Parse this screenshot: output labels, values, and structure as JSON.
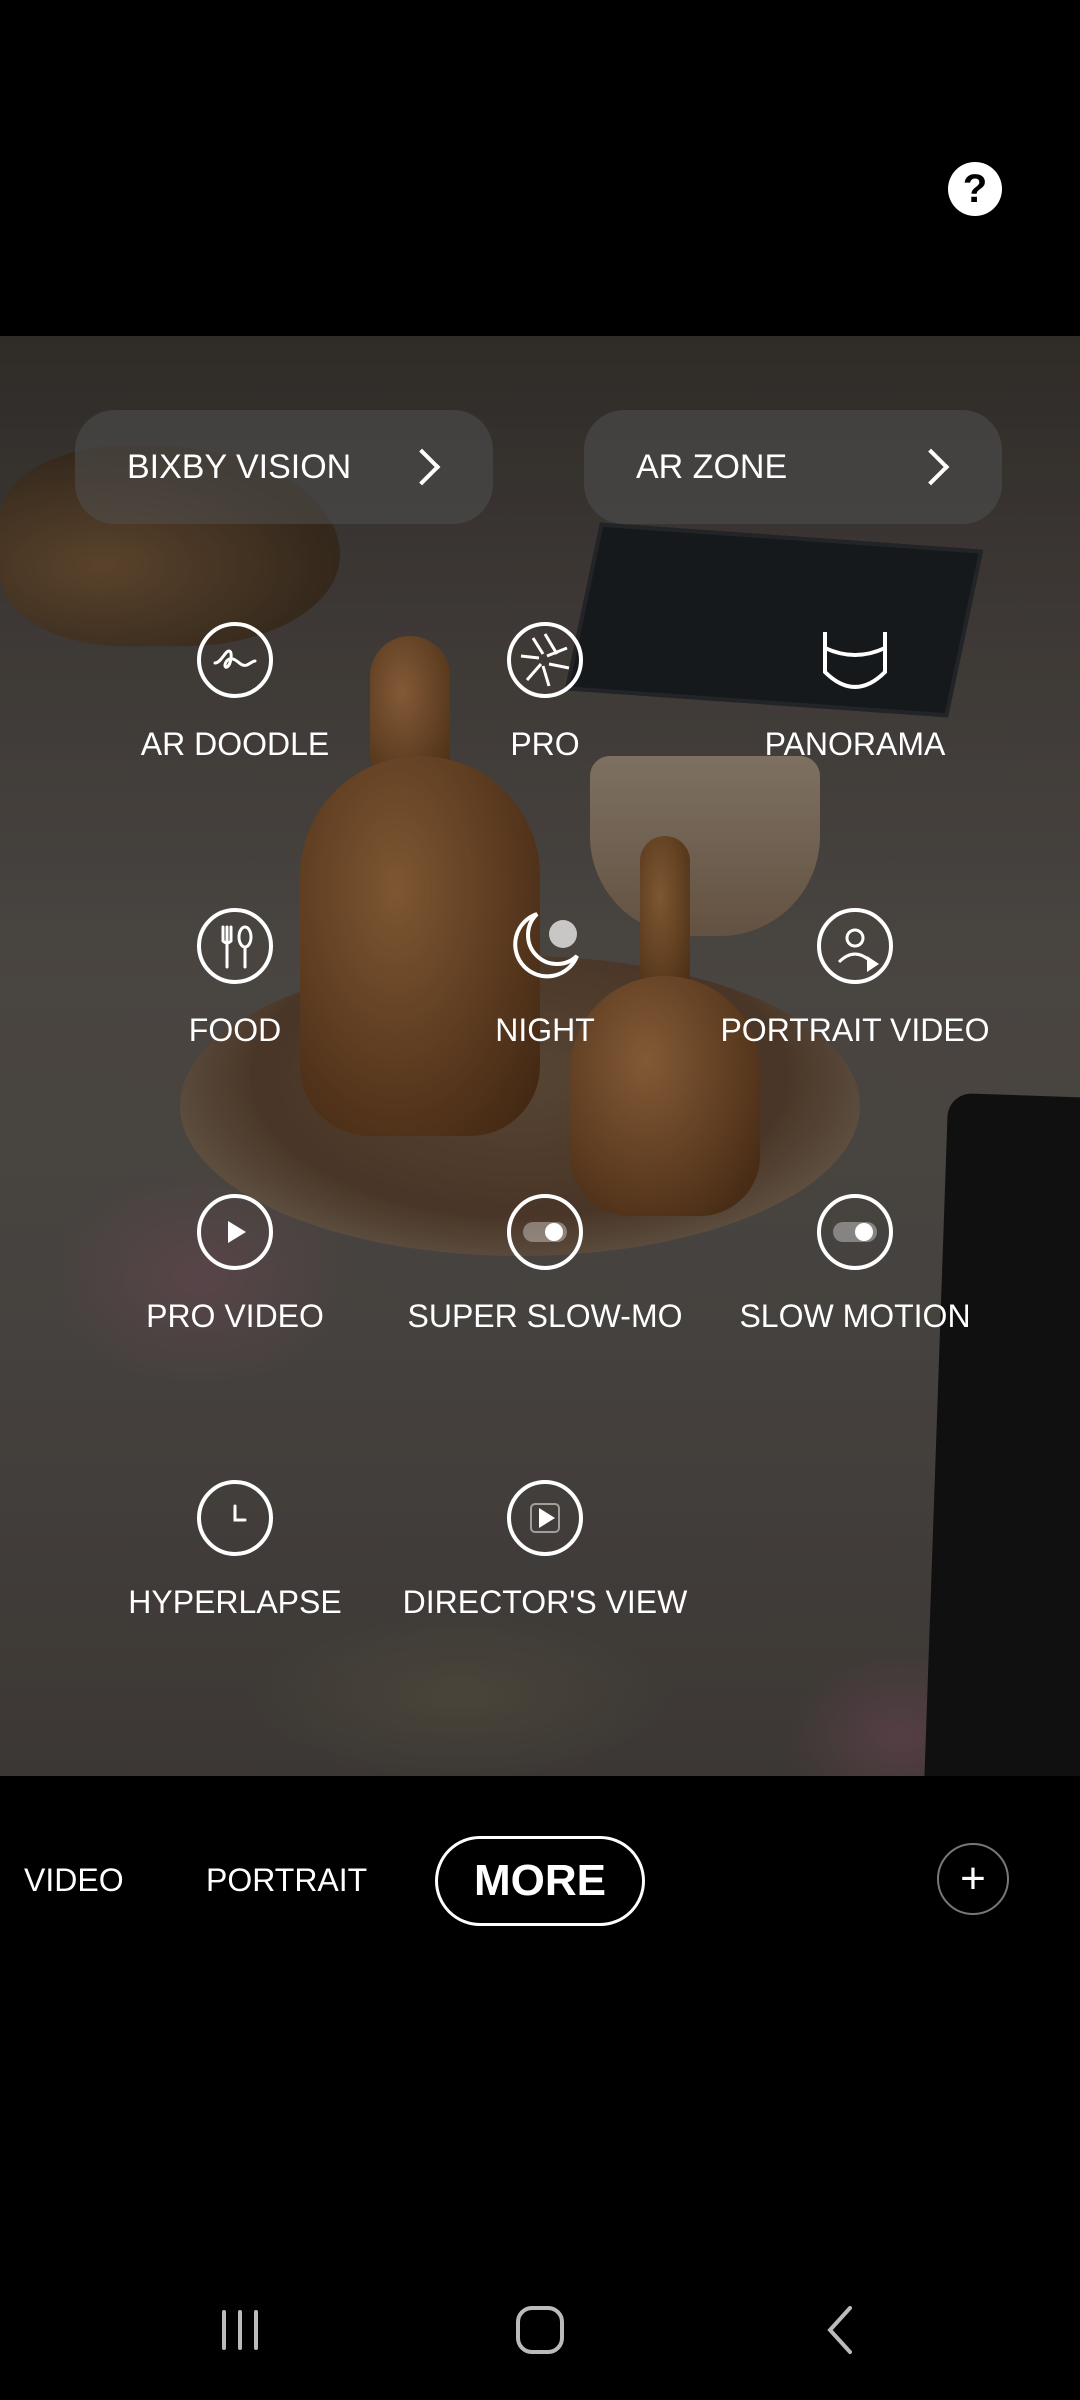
{
  "top": {
    "help_icon": "help-icon",
    "help_glyph": "?"
  },
  "chips": [
    {
      "label": "BIXBY VISION",
      "icon": "chevron-right-icon"
    },
    {
      "label": "AR ZONE",
      "icon": "chevron-right-icon"
    }
  ],
  "modes": [
    {
      "label": "AR DOODLE",
      "icon": "ar-doodle-icon"
    },
    {
      "label": "PRO",
      "icon": "aperture-icon"
    },
    {
      "label": "PANORAMA",
      "icon": "panorama-icon"
    },
    {
      "label": "FOOD",
      "icon": "food-icon"
    },
    {
      "label": "NIGHT",
      "icon": "moon-icon"
    },
    {
      "label": "PORTRAIT VIDEO",
      "icon": "portrait-video-icon"
    },
    {
      "label": "PRO VIDEO",
      "icon": "play-icon"
    },
    {
      "label": "SUPER SLOW-MO",
      "icon": "toggle-icon"
    },
    {
      "label": "SLOW MOTION",
      "icon": "toggle-icon"
    },
    {
      "label": "HYPERLAPSE",
      "icon": "timer-icon"
    },
    {
      "label": "DIRECTOR'S VIEW",
      "icon": "director-view-icon"
    }
  ],
  "mode_bar": {
    "tabs": [
      "VIDEO",
      "PORTRAIT"
    ],
    "selected": "MORE",
    "add_glyph": "+"
  },
  "nav_bar": {
    "recents": "recents-icon",
    "home": "home-icon",
    "back": "back-icon"
  }
}
